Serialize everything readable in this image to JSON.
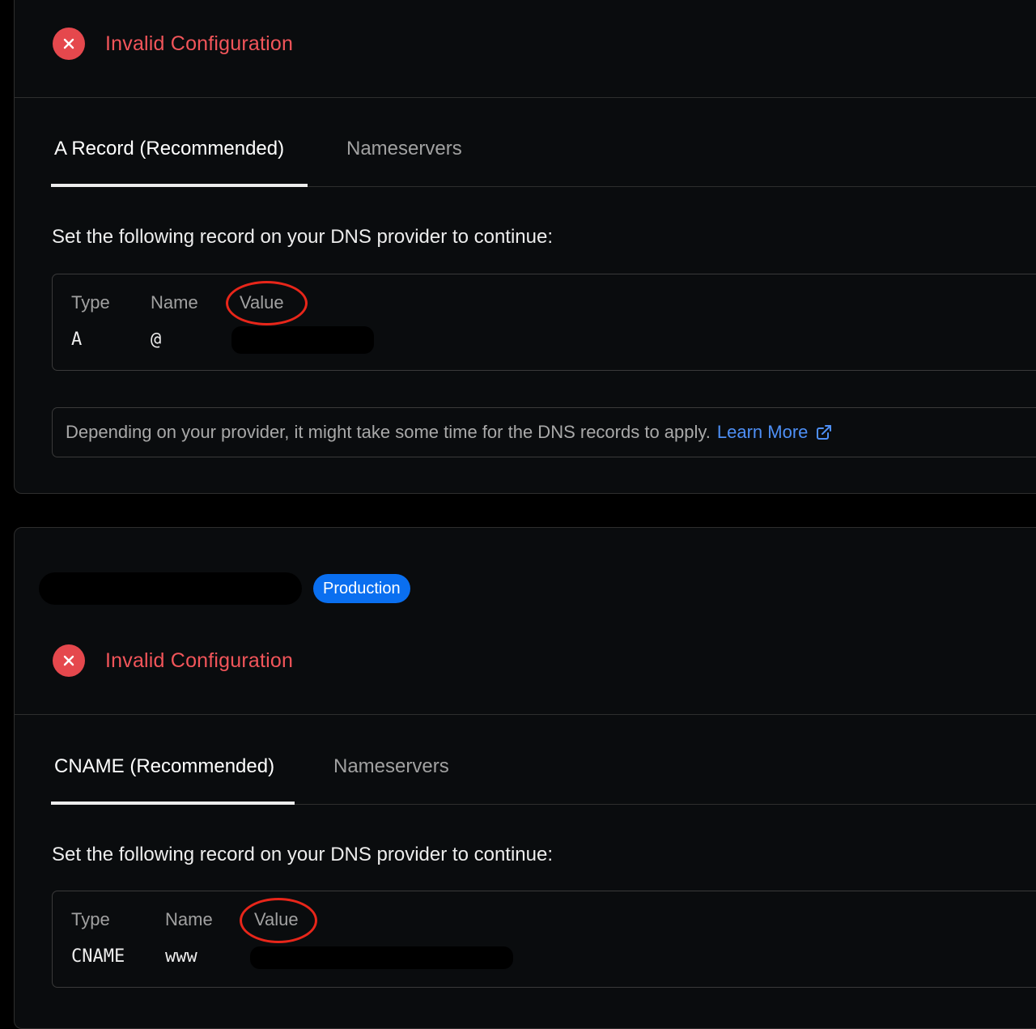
{
  "config_blocks": [
    {
      "status": {
        "label": "Invalid Configuration",
        "icon": "x-circle-icon",
        "color": "#e5484d"
      },
      "tabs": [
        {
          "label": "A Record (Recommended)",
          "active": true
        },
        {
          "label": "Nameservers",
          "active": false
        }
      ],
      "instruction": "Set the following record on your DNS provider to continue:",
      "record": {
        "headers": [
          "Type",
          "Name",
          "Value"
        ],
        "type": "A",
        "name": "@",
        "value_redacted": true
      },
      "note": {
        "text": "Depending on your provider, it might take some time for the DNS records to apply.",
        "link_label": "Learn More",
        "link_icon": "external-link-icon"
      }
    },
    {
      "domain_redacted": true,
      "badge": "Production",
      "status": {
        "label": "Invalid Configuration",
        "icon": "x-circle-icon",
        "color": "#e5484d"
      },
      "tabs": [
        {
          "label": "CNAME (Recommended)",
          "active": true
        },
        {
          "label": "Nameservers",
          "active": false
        }
      ],
      "instruction": "Set the following record on your DNS provider to continue:",
      "record": {
        "headers": [
          "Type",
          "Name",
          "Value"
        ],
        "type": "CNAME",
        "name": "www",
        "value_redacted": true
      }
    }
  ],
  "colors": {
    "error": "#e5484d",
    "link": "#4e8ff5",
    "badge": "#0a6ff0",
    "annotation_ring": "#e8261a",
    "background": "#0a0c0e"
  }
}
